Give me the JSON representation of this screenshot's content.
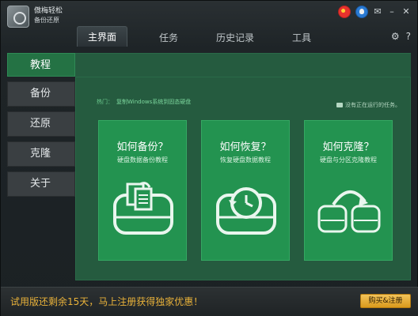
{
  "app": {
    "brand_line1": "傲梅轻松",
    "brand_line2": "备份还原"
  },
  "tabs": [
    "主界面",
    "任务",
    "历史记录",
    "工具"
  ],
  "sidebar": {
    "items": [
      {
        "label": "教程"
      },
      {
        "label": "备份"
      },
      {
        "label": "还原"
      },
      {
        "label": "克隆"
      },
      {
        "label": "关于"
      }
    ]
  },
  "main": {
    "task_note": "没有正在运行的任务。",
    "hot_label": "热门：",
    "hot_link": "复制Windows系统到固态硬盘",
    "cards": [
      {
        "title": "如何备份？",
        "desc": "硬盘数据备份教程",
        "icon": "disk-backup-icon"
      },
      {
        "title": "如何恢复？",
        "desc": "恢复硬盘数据教程",
        "icon": "disk-restore-icon"
      },
      {
        "title": "如何克隆？",
        "desc": "硬盘与分区克隆教程",
        "icon": "disk-clone-icon"
      }
    ]
  },
  "bottom": {
    "trial_text": "试用版还剩余15天，马上注册获得独家优惠！",
    "buy_label": "购买&注册"
  },
  "colors": {
    "accent_green": "#239350",
    "panel_green": "#255b3f",
    "warning_orange": "#e9b23a"
  }
}
